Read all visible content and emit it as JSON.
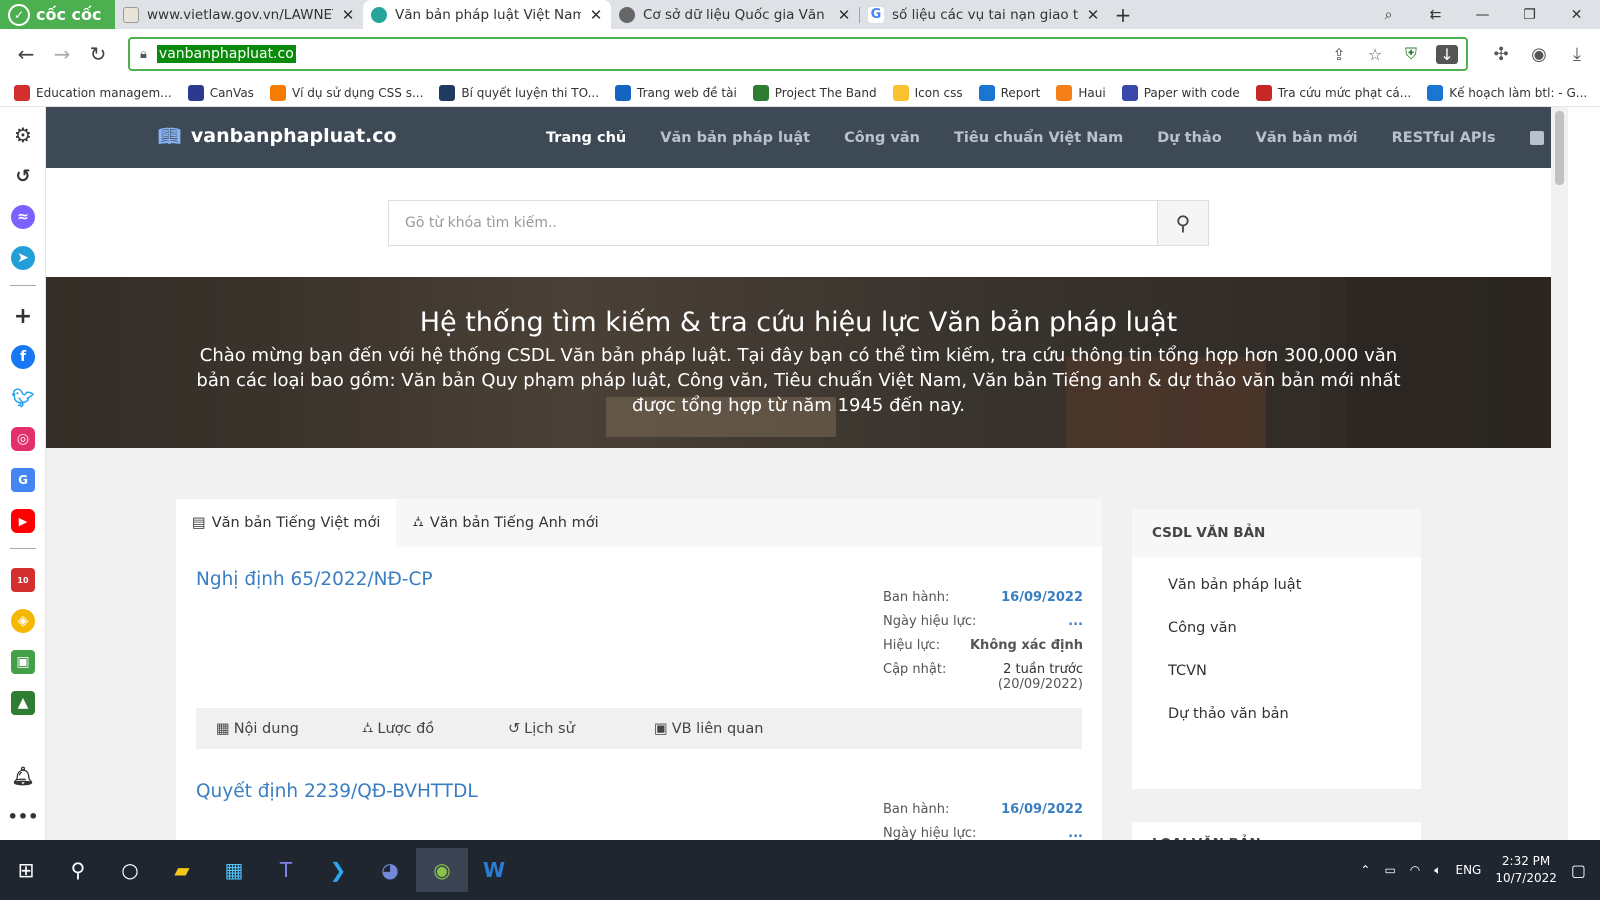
{
  "browser": {
    "brand": "cốc cốc",
    "tabs": [
      {
        "title": "www.vietlaw.gov.vn/LAWNET",
        "active": false
      },
      {
        "title": "Văn bản pháp luật Việt Nam",
        "active": true
      },
      {
        "title": "Cơ sở dữ liệu Quốc gia Văn b",
        "active": false
      },
      {
        "title": "số liệu các vụ tai nạn giao th",
        "active": false
      }
    ],
    "url": "vanbanphapluat.co",
    "bookmarks": [
      {
        "label": "Education managem...",
        "color": "#d32f2f"
      },
      {
        "label": "CanVas",
        "color": "#2b3a8c"
      },
      {
        "label": "Ví dụ sử dụng CSS s...",
        "color": "#f57c00"
      },
      {
        "label": "Bí quyết luyện thi TO...",
        "color": "#1e3a5f"
      },
      {
        "label": "Trang web đề tài",
        "color": "#1565c0"
      },
      {
        "label": "Project The Band",
        "color": "#2e7d32"
      },
      {
        "label": "Icon css",
        "color": "#f9c22e"
      },
      {
        "label": "Report",
        "color": "#1976d2"
      },
      {
        "label": "Haui",
        "color": "#f57f17"
      },
      {
        "label": "Paper with code",
        "color": "#3949ab"
      },
      {
        "label": "Tra cứu mức phạt cá...",
        "color": "#c62828"
      },
      {
        "label": "Kế hoạch làm btl: - G...",
        "color": "#1976d2"
      }
    ]
  },
  "site": {
    "brand": "vanbanphapluat.co",
    "menu": [
      "Trang chủ",
      "Văn bản pháp luật",
      "Công văn",
      "Tiêu chuẩn Việt Nam",
      "Dự thảo",
      "Văn bản mới",
      "RESTful APIs"
    ],
    "search_placeholder": "Gõ từ khóa tìm kiếm..",
    "hero_title": "Hệ thống tìm kiếm & tra cứu hiệu lực Văn bản pháp luật",
    "hero_text": "Chào mừng bạn đến với hệ thống CSDL Văn bản pháp luật. Tại đây bạn có thể tìm kiếm, tra cứu thông tin tổng hợp hơn 300,000 văn bản các loại bao gồm: Văn bản Quy phạm pháp luật, Công văn, Tiêu chuẩn Việt Nam, Văn bản Tiếng anh & dự thảo văn bản mới nhất được tổng hợp từ năm 1945 đến nay."
  },
  "main": {
    "tabs": [
      "Văn bản Tiếng Việt mới",
      "Văn bản Tiếng Anh mới"
    ],
    "docs": [
      {
        "title": "Nghị định 65/2022/NĐ-CP",
        "labels": {
          "issued": "Ban hành:",
          "effective_date": "Ngày hiệu lực:",
          "status": "Hiệu lực:",
          "updated": "Cập nhật:"
        },
        "issued": "16/09/2022",
        "effective_date": "...",
        "status": "Không xác định",
        "updated": "2 tuần trước",
        "updated_date": "(20/09/2022)"
      },
      {
        "title": "Quyết định 2239/QĐ-BVHTTDL",
        "labels": {
          "issued": "Ban hành:",
          "effective_date": "Ngày hiệu lực:"
        },
        "issued": "16/09/2022",
        "effective_date": "..."
      }
    ],
    "actions": [
      "Nội dung",
      "Lược đồ",
      "Lịch sử",
      "VB liên quan"
    ]
  },
  "sidebar_widget": {
    "title": "CSDL VĂN BẢN",
    "items": [
      "Văn bản pháp luật",
      "Công văn",
      "TCVN",
      "Dự thảo văn bản"
    ],
    "next_title": "LOẠI VĂN BẢN"
  },
  "taskbar": {
    "lang": "ENG",
    "time": "2:32 PM",
    "date": "10/7/2022"
  }
}
